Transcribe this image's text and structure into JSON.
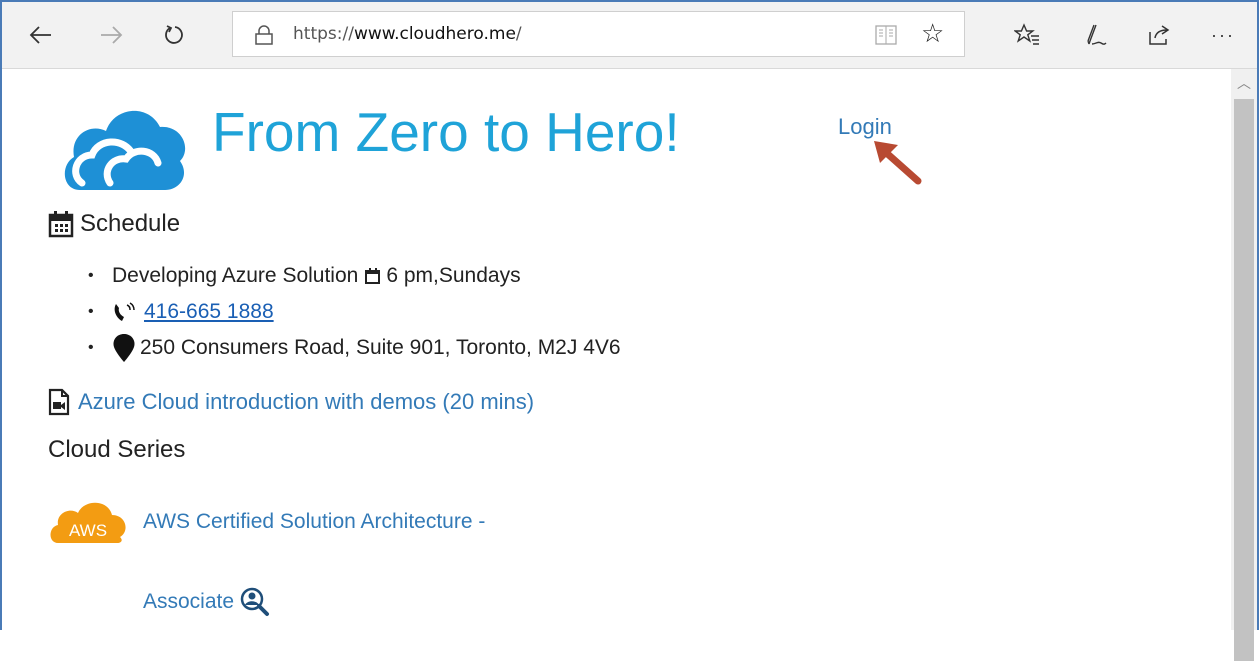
{
  "browser": {
    "url_prefix": "https://",
    "url_domain": "www.cloudhero.me",
    "url_suffix": "/",
    "icons": [
      "back-icon",
      "forward-icon",
      "refresh-icon",
      "lock-icon",
      "reading-view-icon",
      "favorite-star-icon",
      "favorites-list-icon",
      "pen-icon",
      "share-icon",
      "more-icon"
    ],
    "more_label": "···"
  },
  "page": {
    "title": "From Zero to Hero!",
    "login": "Login",
    "schedule_heading": "Schedule",
    "schedule_items": [
      {
        "text": "Developing Azure Solution",
        "time": "6 pm,Sundays"
      },
      {
        "phone": "416-665 1888"
      },
      {
        "address": "250 Consumers Road, Suite 901, Toronto, M2J 4V6"
      }
    ],
    "video_link": "Azure Cloud introduction with demos (20 mins)",
    "series_heading": "Cloud Series",
    "aws_link_line1": "AWS Certified Solution Architecture -",
    "aws_link_line2": "Associate",
    "aws_logo_text": "AWS"
  },
  "colors": {
    "title": "#1fa3d8",
    "link": "#337ab7",
    "arrow": "#b84a32",
    "aws_orange": "#f39c12",
    "cloud_blue": "#1e90d6"
  }
}
